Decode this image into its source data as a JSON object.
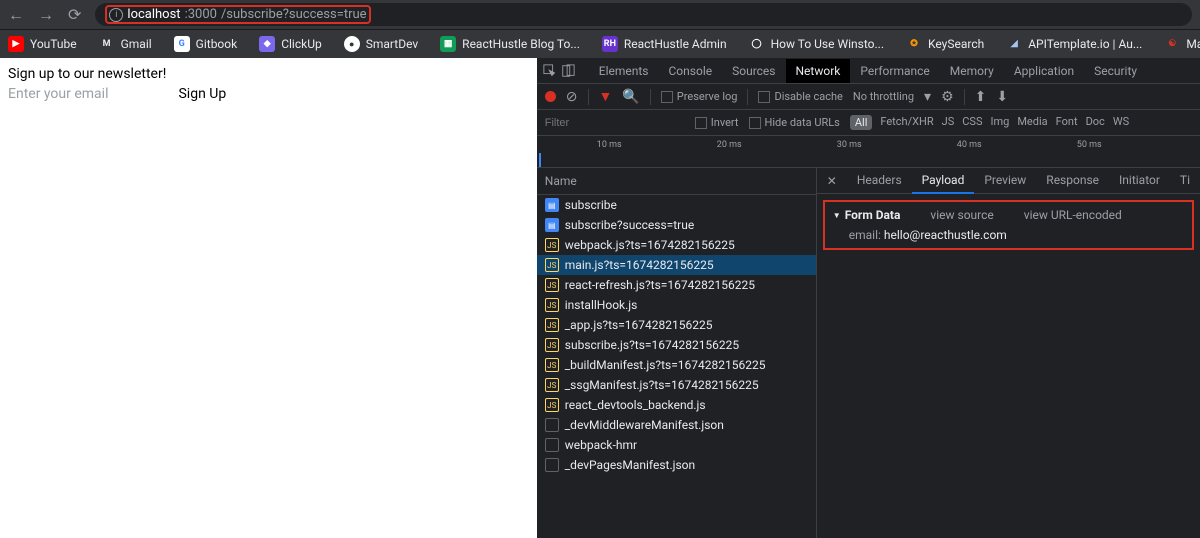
{
  "url": {
    "domain": "localhost",
    "port": ":3000",
    "path": "/subscribe?success=true"
  },
  "bookmarks": [
    {
      "label": "YouTube",
      "iconClass": "ic-yt",
      "iconText": "▶"
    },
    {
      "label": "Gmail",
      "iconClass": "ic-gm",
      "iconText": "M"
    },
    {
      "label": "Gitbook",
      "iconClass": "ic-gb",
      "iconText": "G"
    },
    {
      "label": "ClickUp",
      "iconClass": "ic-cu",
      "iconText": "◆"
    },
    {
      "label": "SmartDev",
      "iconClass": "ic-sd",
      "iconText": "●"
    },
    {
      "label": "ReactHustle Blog To...",
      "iconClass": "ic-sh",
      "iconText": "▦"
    },
    {
      "label": "ReactHustle Admin",
      "iconClass": "ic-rh",
      "iconText": "RH"
    },
    {
      "label": "How To Use Winsto...",
      "iconClass": "ic-gh",
      "iconText": "◯"
    },
    {
      "label": "KeySearch",
      "iconClass": "ic-ks",
      "iconText": "✪"
    },
    {
      "label": "APITemplate.io | Au...",
      "iconClass": "ic-at",
      "iconText": "◢"
    },
    {
      "label": "Mantak Chia - How",
      "iconClass": "ic-mc",
      "iconText": "☯"
    }
  ],
  "page": {
    "heading": "Sign up to our newsletter!",
    "emailPlaceholder": "Enter your email",
    "signUpBtn": "Sign Up"
  },
  "devtools": {
    "tabs": [
      "Elements",
      "Console",
      "Sources",
      "Network",
      "Performance",
      "Memory",
      "Application",
      "Security"
    ],
    "activeTab": "Network",
    "controls": {
      "preserveLog": "Preserve log",
      "disableCache": "Disable cache",
      "throttling": "No throttling"
    },
    "filter": {
      "placeholder": "Filter",
      "invert": "Invert",
      "hideDataUrls": "Hide data URLs",
      "types": [
        "All",
        "Fetch/XHR",
        "JS",
        "CSS",
        "Img",
        "Media",
        "Font",
        "Doc",
        "WS"
      ],
      "activeType": "All"
    },
    "timeline": [
      "10 ms",
      "20 ms",
      "30 ms",
      "40 ms",
      "50 ms"
    ],
    "nameHeader": "Name",
    "requests": [
      {
        "name": "subscribe",
        "type": "doc"
      },
      {
        "name": "subscribe?success=true",
        "type": "doc"
      },
      {
        "name": "webpack.js?ts=1674282156225",
        "type": "js"
      },
      {
        "name": "main.js?ts=1674282156225",
        "type": "js",
        "selected": true
      },
      {
        "name": "react-refresh.js?ts=1674282156225",
        "type": "js"
      },
      {
        "name": "installHook.js",
        "type": "js"
      },
      {
        "name": "_app.js?ts=1674282156225",
        "type": "js"
      },
      {
        "name": "subscribe.js?ts=1674282156225",
        "type": "js"
      },
      {
        "name": "_buildManifest.js?ts=1674282156225",
        "type": "js"
      },
      {
        "name": "_ssgManifest.js?ts=1674282156225",
        "type": "js"
      },
      {
        "name": "react_devtools_backend.js",
        "type": "js"
      },
      {
        "name": "_devMiddlewareManifest.json",
        "type": "other"
      },
      {
        "name": "webpack-hmr",
        "type": "other"
      },
      {
        "name": "_devPagesManifest.json",
        "type": "other"
      }
    ],
    "detailTabs": [
      "Headers",
      "Payload",
      "Preview",
      "Response",
      "Initiator",
      "Ti"
    ],
    "activeDetailTab": "Payload",
    "payload": {
      "formDataLabel": "Form Data",
      "viewSource": "view source",
      "viewUrlEncoded": "view URL-encoded",
      "fields": [
        {
          "key": "email:",
          "value": "hello@reacthustle.com"
        }
      ]
    }
  }
}
